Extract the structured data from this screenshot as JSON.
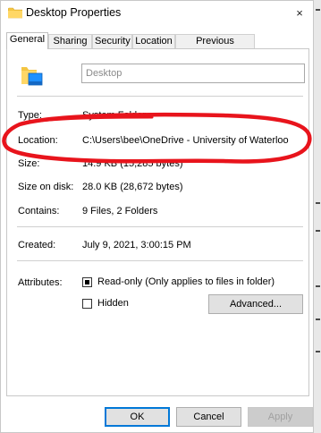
{
  "window": {
    "title": "Desktop Properties",
    "close_glyph": "×"
  },
  "tabs": [
    {
      "label": "General",
      "active": true
    },
    {
      "label": "Sharing"
    },
    {
      "label": "Security"
    },
    {
      "label": "Location"
    },
    {
      "label": "Previous Versions"
    }
  ],
  "general": {
    "name_value": "Desktop",
    "type_label": "Type:",
    "type_value": "System Folder",
    "location_label": "Location:",
    "location_value": "C:\\Users\\bee\\OneDrive - University of Waterloo",
    "size_label": "Size:",
    "size_value": "14.9 KB (15,285 bytes)",
    "size_on_disk_label": "Size on disk:",
    "size_on_disk_value": "28.0 KB (28,672 bytes)",
    "contains_label": "Contains:",
    "contains_value": "9 Files, 2 Folders",
    "created_label": "Created:",
    "created_value": "July 9, 2021, 3:00:15 PM",
    "attributes_label": "Attributes:",
    "readonly_label": "Read-only (Only applies to files in folder)",
    "readonly_checked": true,
    "hidden_label": "Hidden",
    "hidden_checked": false,
    "advanced_label": "Advanced..."
  },
  "footer": {
    "ok_label": "OK",
    "cancel_label": "Cancel",
    "apply_label": "Apply"
  },
  "colors": {
    "annotation": "#e8141c",
    "folder_yellow": "#f4c542",
    "accent": "#0078d7"
  }
}
